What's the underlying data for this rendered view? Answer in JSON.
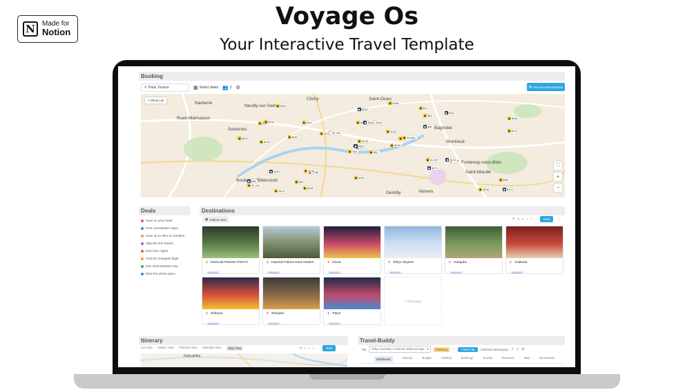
{
  "badge": {
    "small": "Made for",
    "big": "Notion",
    "logo_letter": "N"
  },
  "header": {
    "title": "Voyage Os",
    "subtitle": "Your Interactive Travel Template"
  },
  "booking": {
    "heading": "Booking",
    "search": {
      "location": "Paris, France",
      "dates": "Select dates",
      "guests": "2"
    },
    "see_button": "See accommodations",
    "show_list": "Show List",
    "map_labels": [
      "Neuilly-sur-Seine",
      "Rueil-Malmaison",
      "Suresnes",
      "Boulogne-Billancourt",
      "Montreuil",
      "Bagnolet",
      "Fontenay-sous-Bois",
      "Saint-Mandé",
      "Vanves",
      "Gentilly",
      "Nanterre",
      "Clichy",
      "Saint-Ouen"
    ],
    "markers": [
      "$91",
      "$56",
      "$374",
      "$98",
      "$193",
      "$258",
      "$41",
      "$164",
      "$89",
      "$209",
      "$249",
      "$223",
      "$134",
      "$384",
      "$33",
      "$88",
      "$118",
      "$332",
      "$139",
      "$164",
      "$1,351",
      "$1,124",
      "$947",
      "$340",
      "$2,563",
      "$191",
      "$154",
      "$945",
      "$220",
      "$1,057",
      "$123",
      "$947",
      "$332",
      "$139",
      "$111",
      "$151",
      "$246",
      "$258",
      "$597",
      "$213",
      "$258",
      "$231",
      "$163",
      "$270",
      "$258"
    ]
  },
  "deals": {
    "heading": "Deals",
    "items": [
      {
        "label": "Save on your hotel",
        "color": "#e05b4b"
      },
      {
        "label": "Free cancellation stays",
        "color": "#3b82d6"
      },
      {
        "label": "Save up to 30% on bundles",
        "color": "#f29c38"
      },
      {
        "label": "Skip-the-line tickets",
        "color": "#8b5cf6"
      },
      {
        "label": "Earn free nights",
        "color": "#e05b4b"
      },
      {
        "label": "Find the cheapest flight",
        "color": "#f29c38"
      },
      {
        "label": "See what travelers say",
        "color": "#22b07d"
      },
      {
        "label": "Rent the whole place",
        "color": "#3b82d6"
      }
    ]
  },
  "destinations": {
    "heading": "Destinations",
    "view_label": "Gallery view",
    "new_button": "New",
    "new_page": "New page",
    "cards": [
      {
        "name": "teamLab Planets TOKYO",
        "tag": "Planned"
      },
      {
        "name": "Imperial Palace East Garden",
        "tag": "Planned"
      },
      {
        "name": "Ginza",
        "tag": "Planned"
      },
      {
        "name": "Tokyo Skytree",
        "tag": "Planned"
      },
      {
        "name": "Harajuku",
        "tag": "Planned"
      },
      {
        "name": "Asakusa",
        "tag": "Planned"
      },
      {
        "name": "Shibuya",
        "tag": "Planned"
      },
      {
        "name": "Shinjuku",
        "tag": "Planned"
      },
      {
        "name": "Tokyo",
        "tag": "Planned"
      }
    ]
  },
  "itinerary": {
    "heading": "Itinerary",
    "tabs": [
      "List View",
      "Gallery View",
      "Timeline View",
      "Calendar View",
      "Map View"
    ],
    "new_button": "New",
    "map_labels": [
      "Katsushika"
    ]
  },
  "travel_buddy": {
    "heading": "Travel-Buddy",
    "trip_label": "Trip",
    "trip_value": "Tokyo Serenity: A Natural Urban Escape",
    "status": "Planning",
    "new_trip": "New Trip",
    "workspace_text": "Unlimited Workspace",
    "tabs": [
      "Dashboard",
      "Itinerary",
      "Budget",
      "Packing",
      "Bookings",
      "Journal",
      "Research",
      "Map",
      "Geolocation"
    ]
  }
}
